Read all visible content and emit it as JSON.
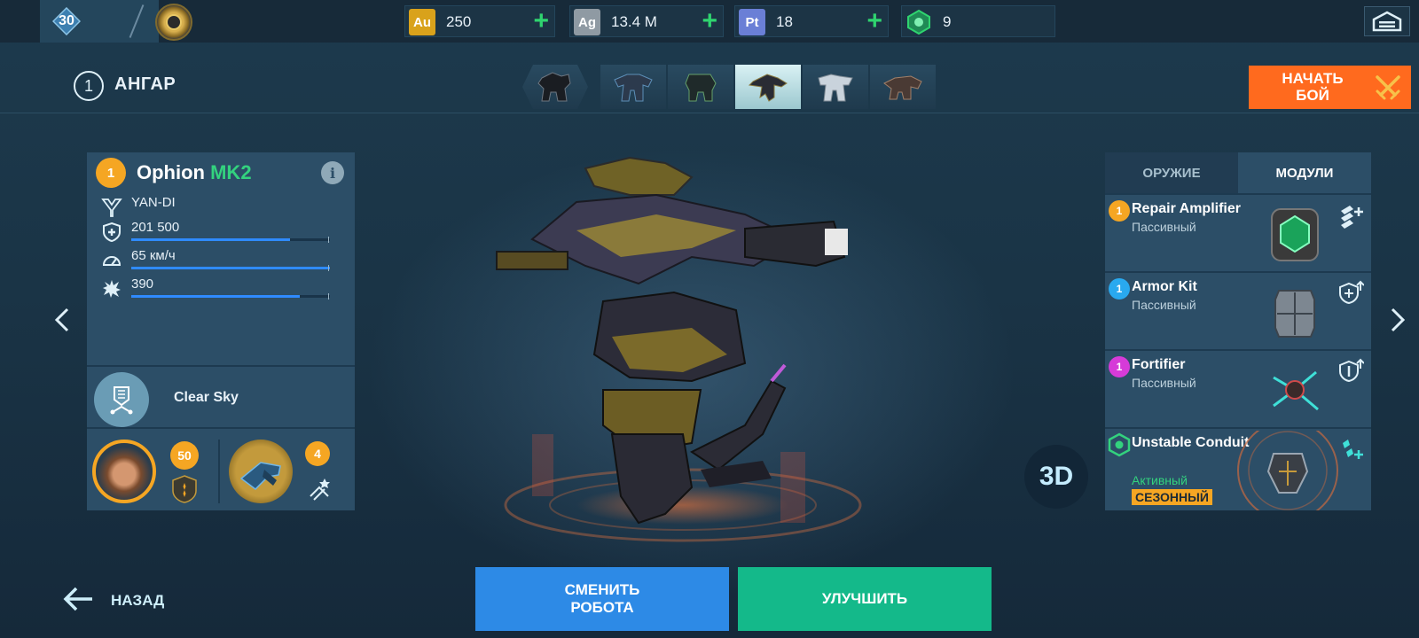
{
  "player": {
    "level": "30"
  },
  "currencies": [
    {
      "icon": "gold-icon",
      "code": "Au",
      "value": "250",
      "color": "#d9a21b"
    },
    {
      "icon": "silver-icon",
      "code": "Ag",
      "value": "13.4 M",
      "color": "#8f9aa3"
    },
    {
      "icon": "platinum-icon",
      "code": "Pt",
      "value": "18",
      "color": "#6a7fd6"
    },
    {
      "icon": "key-token-icon",
      "code": "",
      "value": "9",
      "color": "#2fd46f"
    }
  ],
  "hangar": {
    "number": "1",
    "title": "АНГАР"
  },
  "robot_tabs": [
    "robot-1",
    "robot-2",
    "robot-3",
    "robot-4",
    "robot-5",
    "robot-6"
  ],
  "active_robot_tab": 3,
  "start_battle": {
    "label_line1": "НАЧАТЬ",
    "label_line2": "БОЙ"
  },
  "robot": {
    "tier": "1",
    "name": "Ophion",
    "mark": "MK2",
    "manufacturer": "YAN-DI",
    "ability": "Clear Sky",
    "view_3d": "3D"
  },
  "chart_data": {
    "type": "bar",
    "categories": [
      "health",
      "speed",
      "damage"
    ],
    "values": [
      0.8,
      1.0,
      0.85
    ],
    "labels": [
      "201 500",
      "65 км/ч",
      "390"
    ],
    "ylim": [
      0,
      1
    ]
  },
  "pilot": {
    "level": "50"
  },
  "drone": {
    "level": "4"
  },
  "right_tabs": {
    "weapons": "ОРУЖИЕ",
    "modules": "МОДУЛИ"
  },
  "modules": [
    {
      "tier": "1",
      "tier_color": "#f5a623",
      "name": "Repair Amplifier",
      "type": "Пассивный",
      "icon": "repair-amplifier-icon"
    },
    {
      "tier": "1",
      "tier_color": "#29a9ef",
      "name": "Armor Kit",
      "type": "Пассивный",
      "icon": "armor-kit-icon"
    },
    {
      "tier": "1",
      "tier_color": "#d63bd8",
      "name": "Fortifier",
      "type": "Пассивный",
      "icon": "fortifier-icon"
    },
    {
      "tier": "",
      "tier_color": "#33d27e",
      "name": "Unstable Conduit",
      "type": "Активный",
      "tag": "СЕЗОННЫЙ",
      "icon": "unstable-conduit-icon"
    }
  ],
  "bottom": {
    "back": "НАЗАД",
    "change_robot_line1": "СМЕНИТЬ",
    "change_robot_line2": "РОБОТА",
    "upgrade": "УЛУЧШИТЬ"
  }
}
